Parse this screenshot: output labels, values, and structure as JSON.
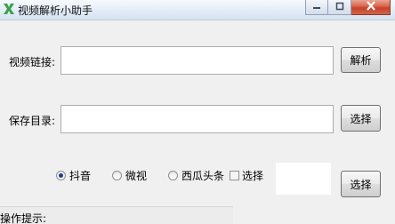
{
  "window": {
    "title": "视频解析小助手",
    "icon": "app-logo-icon",
    "controls": {
      "minimize": "minimize-icon",
      "maximize": "maximize-icon",
      "close": "close-icon"
    }
  },
  "link_row": {
    "label": "视频链接:",
    "value": "",
    "button_label": "解析"
  },
  "save_row": {
    "label": "保存目录:",
    "value": "",
    "button_label": "选择"
  },
  "platform_options": [
    {
      "label": "抖音",
      "type": "radio",
      "checked": true
    },
    {
      "label": "微视",
      "type": "radio",
      "checked": false
    },
    {
      "label": "西瓜头条",
      "type": "radio",
      "checked": false
    },
    {
      "label": "选择",
      "type": "checkbox",
      "checked": false
    }
  ],
  "select_button_label": "选择",
  "status": {
    "label": "操作提示:"
  },
  "colors": {
    "accent": "#1f3f8a",
    "close_button": "#c44228"
  }
}
